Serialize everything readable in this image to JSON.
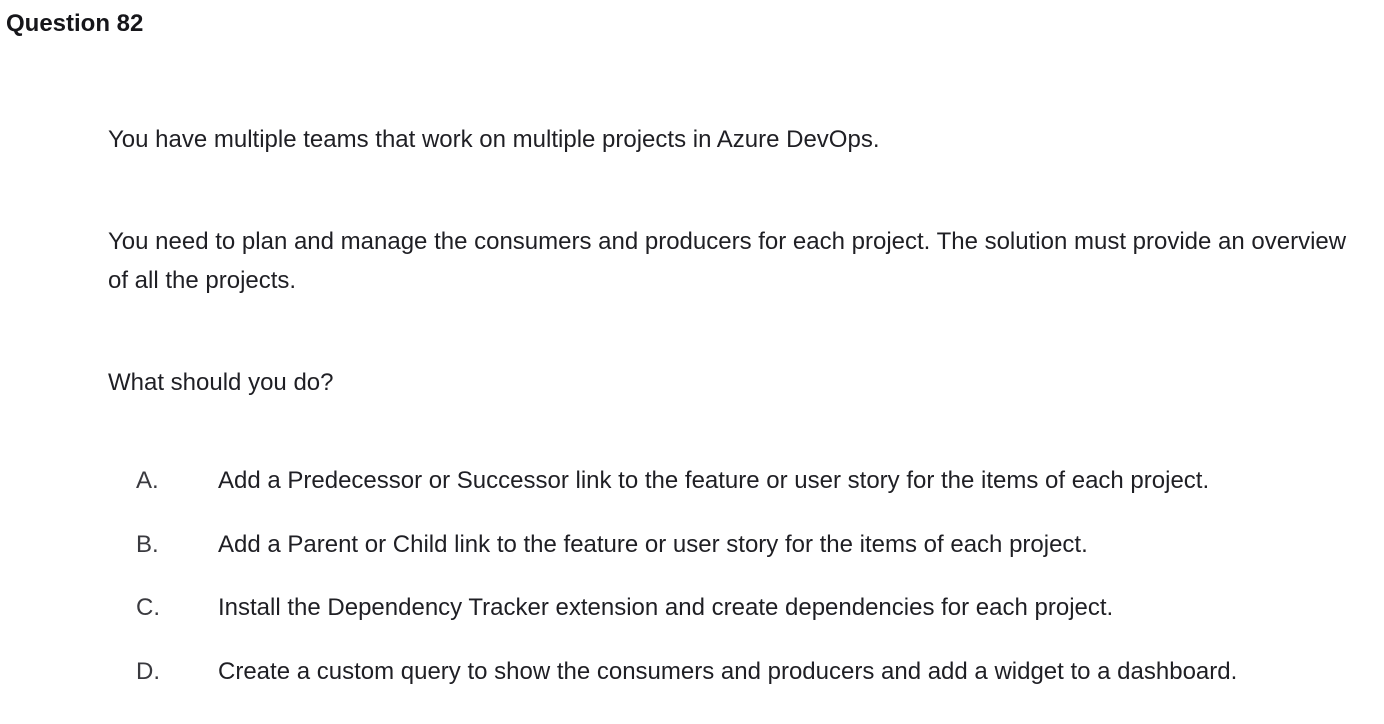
{
  "question": {
    "title": "Question 82",
    "paragraphs": [
      "You have multiple teams that work on multiple projects in Azure DevOps.",
      "You need to plan and manage the consumers and producers for each project. The solution must provide an overview of all the projects.",
      "What should you do?"
    ],
    "options": [
      {
        "letter": "A.",
        "text": "Add a Predecessor or Successor link to the feature or user story for the items of each project."
      },
      {
        "letter": "B.",
        "text": "Add a Parent or Child link to the feature or user story for the items of each project."
      },
      {
        "letter": "C.",
        "text": "Install the Dependency Tracker extension and create dependencies for each project."
      },
      {
        "letter": "D.",
        "text": "Create a custom query to show the consumers and producers and add a widget to a dashboard."
      }
    ]
  }
}
